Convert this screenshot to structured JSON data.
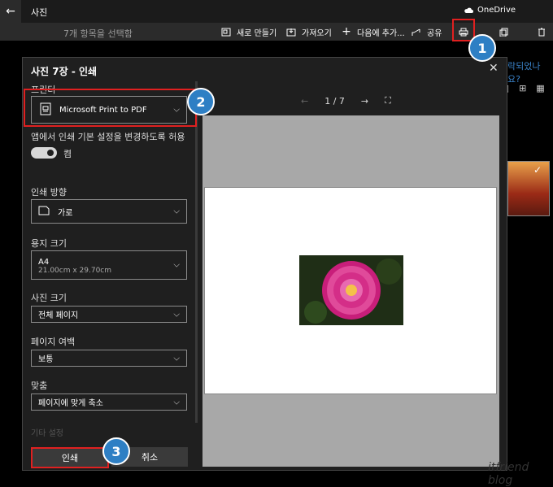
{
  "titlebar": {
    "back": "←",
    "app_title": "사진",
    "onedrive": "OneDrive"
  },
  "toolbar": {
    "selection": "7개 항목을 선택함",
    "create": "새로 만들기",
    "import": "가져오기",
    "add_to": "다음에 추가...",
    "share": "공유"
  },
  "background": {
    "partial_text": "락되었나요?"
  },
  "dialog": {
    "title": "사진 7장 - 인쇄",
    "close": "✕",
    "printer_label": "프린터",
    "printer_value": "Microsoft Print to PDF",
    "allow_label": "앱에서 인쇄 기본 설정을 변경하도록 허용",
    "toggle_state": "켬",
    "orientation_label": "인쇄 방향",
    "orientation_value": "가로",
    "paper_label": "용지 크기",
    "paper_value": "A4",
    "paper_dims": "21.00cm x 29.70cm",
    "photo_size_label": "사진 크기",
    "photo_size_value": "전체 페이지",
    "margin_label": "페이지 여백",
    "margin_value": "보통",
    "fit_label": "맞춤",
    "fit_value": "페이지에 맞게 축소",
    "more_settings": "기타 설정",
    "print_button": "인쇄",
    "cancel_button": "취소",
    "page_indicator": "1 / 7"
  },
  "callouts": [
    "1",
    "2",
    "3"
  ],
  "watermark": "itfriend blog"
}
